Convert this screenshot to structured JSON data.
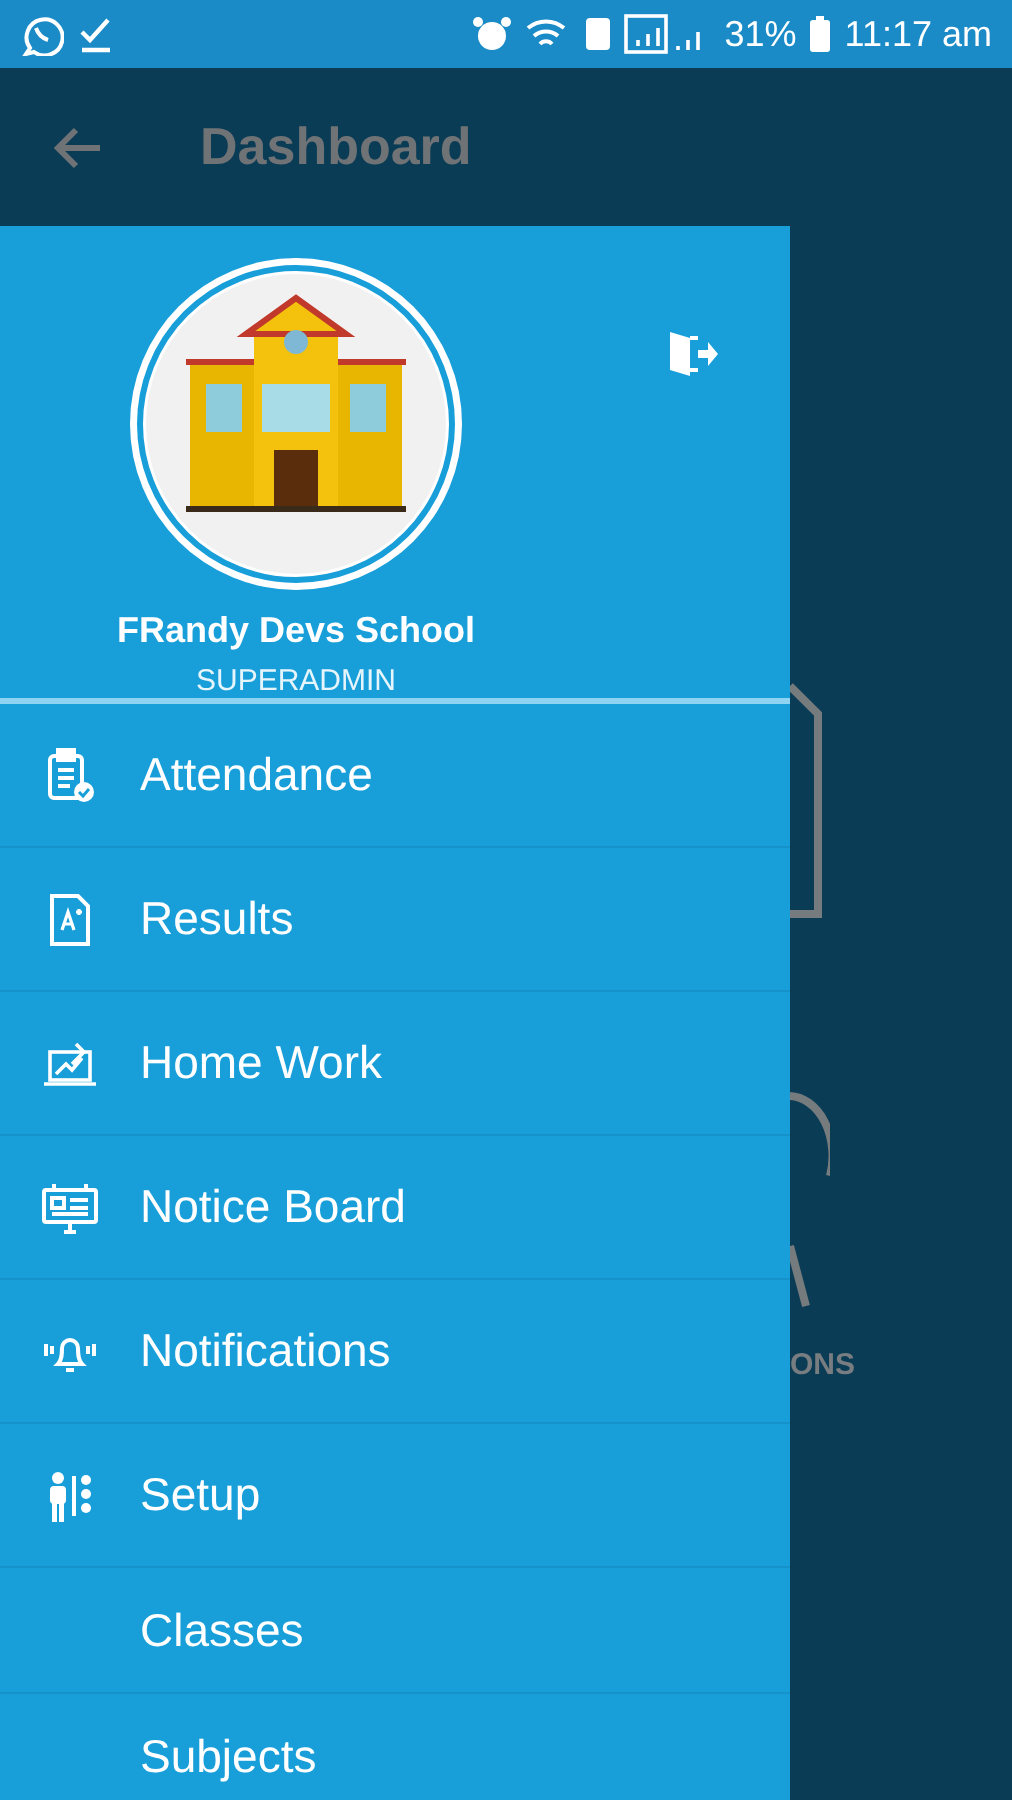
{
  "status_bar": {
    "battery": "31%",
    "time": "11:17 am"
  },
  "app_bar": {
    "title": "Dashboard"
  },
  "background": {
    "labels": [
      "ONS"
    ]
  },
  "drawer": {
    "school_name": "FRandy Devs School",
    "role": "SUPERADMIN",
    "items": [
      {
        "label": "Attendance",
        "kind": "icon"
      },
      {
        "label": "Results",
        "kind": "icon"
      },
      {
        "label": "Home Work",
        "kind": "icon"
      },
      {
        "label": "Notice Board",
        "kind": "icon"
      },
      {
        "label": "Notifications",
        "kind": "icon"
      },
      {
        "label": "Setup",
        "kind": "icon"
      },
      {
        "label": "Classes",
        "kind": "sub"
      },
      {
        "label": "Subjects",
        "kind": "sub"
      }
    ]
  }
}
